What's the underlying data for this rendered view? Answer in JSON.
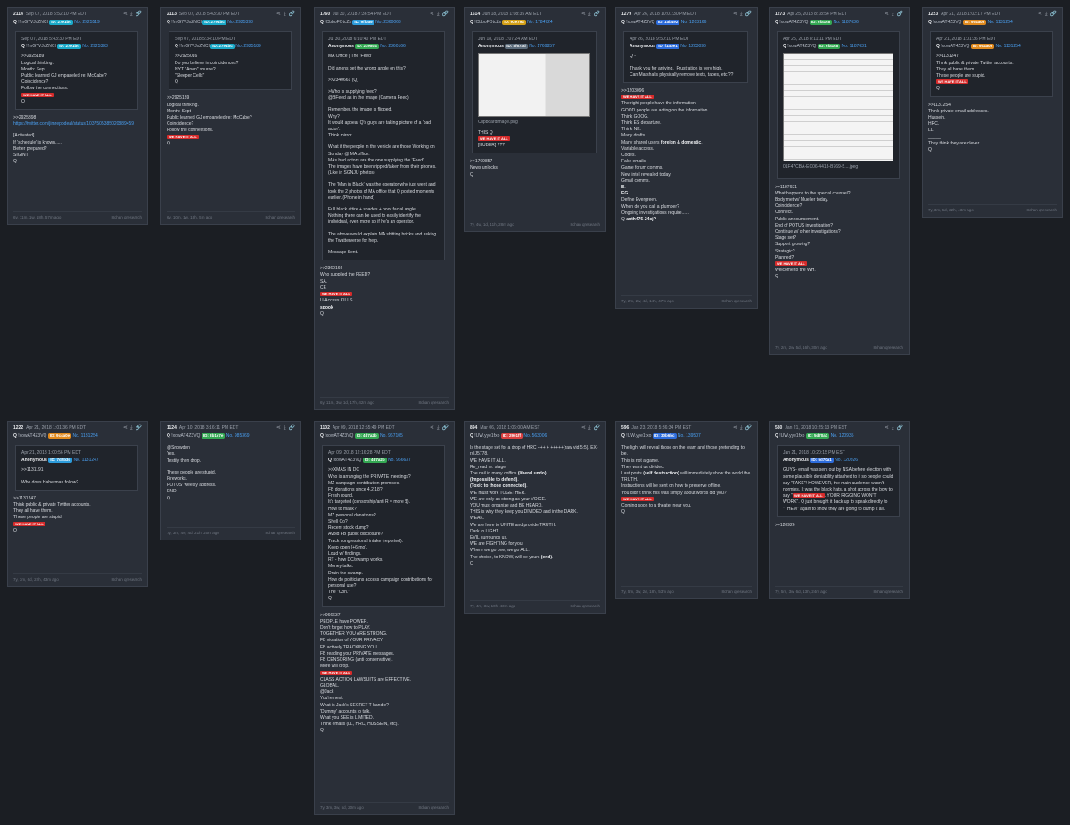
{
  "colors": {
    "bg": "#1b1e23",
    "card": "#2a2f38",
    "link": "#4a9ff0",
    "stamp": "#d62b2b"
  },
  "icons": [
    "share-icon",
    "download-icon",
    "link-icon"
  ],
  "stamp": "WE HAVE IT ALL",
  "posts": [
    {
      "num": "2114",
      "date": "Sep 07, 2018 5:52:10 PM EDT",
      "name": "Q",
      "trip": "!!mG7VJxZNCI",
      "pill": "ID: 27e1bc",
      "pillColor": "#1aa9c8",
      "no": "No. 2925519",
      "quote": {
        "date": "Sep 07, 2018 5:43:30 PM EDT",
        "name": "Q",
        "trip": "!!mG7VJxZNCI",
        "pill": "ID: 27e1bc",
        "pillColor": "#1aa9c8",
        "no": "No. 2925393",
        "lines": [
          ">>2925189",
          "Logical thinking.",
          "Month: Sept",
          "Public learned GJ empaneled re: McCabe?",
          "Coincidence?",
          "Follow the connections.",
          "@STAMP",
          "Q"
        ]
      },
      "lines": [
        ">>2925398",
        "@LINK https://twitter.com/jimrepodeal/status/1037505385020889459",
        "",
        "[Activated]",
        "If 'schedule' is known.....",
        "Better prepared?",
        "SIGINT",
        "Q"
      ],
      "ago": "6y, 11m, 1w, 18h, 57m ago",
      "src": "8chan qresearch"
    },
    {
      "num": "2113",
      "date": "Sep 07, 2018 5:43:30 PM EDT",
      "name": "Q",
      "trip": "!!mG7VJxZNCI",
      "pill": "ID: 27e1bc",
      "pillColor": "#1aa9c8",
      "no": "No. 2925393",
      "quote": {
        "date": "Sep 07, 2018 5:34:10 PM EDT",
        "name": "Q",
        "trip": "!!mG7VJxZNCI",
        "pill": "ID: 27e1bc",
        "pillColor": "#1aa9c8",
        "no": "No. 2925189",
        "lines": [
          ">>2925016",
          "Do you believe in coincidences?",
          "NYT \"Anon\" source?",
          "\"Sleeper Cells\"",
          "Q"
        ]
      },
      "lines": [
        ">>2925189",
        "Logical thinking.",
        "Month: Sept",
        "Public learned GJ empaneled re: McCabe?",
        "Coincidence?",
        "Follow the connections.",
        "@STAMP",
        "Q"
      ],
      "ago": "6y, 10m, 1w, 18h, 5m ago",
      "src": "8chan qresearch"
    },
    {
      "num": "1760",
      "date": "Jul 30, 2018 7:36:54 PM EDT",
      "name": "Q",
      "trip": "!CbboFOtcZs",
      "pill": "ID: 9ff0a9",
      "pillColor": "#2d9cdb",
      "no": "No. 2360063",
      "quote": {
        "date": "Jul 30, 2018 6:10:40 PM EDT",
        "name": "Anonymous",
        "trip": "",
        "pill": "ID: 2ce8d4",
        "pillColor": "#34a853",
        "no": "No. 2360166",
        "lines": [
          "MA Office | The 'Feed'",
          "",
          "Did anons get the wrong angle on this?",
          "",
          ">>2340661 (Q)",
          "",
          ">Who is supplying feed?",
          "@BFeed as in the Image (Camera Feed)",
          "",
          "Remember, the image is flipped.",
          "Why?",
          "It would appear Q's guys are taking picture of a 'bad actor'.",
          "Think mirror.",
          "",
          "What if the people in the vehicle are those Working on Sunday @ MA office.",
          "MAs bad actors are the one supplying the 'Feed'.",
          "The images have been ripped/taken from their phones. (Like in SGNJU photos)",
          "",
          "The 'Man in Black' was the operator who just went and took the 2 photos of MA office that Q posted moments earlier. (Phone in hand)",
          "",
          "Full black attire + shades + poor facial angle.",
          "Nothing there can be used to easily identify the individual, even more so if he's an operator.",
          "",
          "The above would explain MA shitting bricks and asking the Twatterverse for help.",
          "",
          "Message Sent."
        ]
      },
      "lines": [
        ">>2360166",
        "Who supplied the FEED?",
        "SA.",
        "CF.",
        "@STAMP",
        "U-Access KILLS.",
        "@B[spook]",
        "Q"
      ],
      "ago": "6y, 11m, 3w, 1d, 17h, 42m ago",
      "src": "8chan qresearch"
    },
    {
      "num": "1514",
      "date": "Jun 18, 2018 1:08:35 AM EDT",
      "name": "Q",
      "trip": "!CbboFOtcZs",
      "pill": "ID: e2e79a",
      "pillColor": "#d4a017",
      "no": "No. 1784724",
      "quote": {
        "date": "Jun 18, 2018 1:07:24 AM EDT",
        "name": "Anonymous",
        "trip": "",
        "pill": "ID: 8f67ad",
        "pillColor": "#5b6b7a",
        "no": "No. 1769857",
        "image": true,
        "imgcap": "Clipboardimage.png",
        "lines": [
          "THIS Q",
          "@STAMP",
          "[HUBER] ???"
        ]
      },
      "lines": [
        ">>1769857",
        "News unlocks.",
        "Q"
      ],
      "ago": "7y, 4w, 1d, 11h, 28m ago",
      "src": "8chan qresearch"
    },
    {
      "num": "1279",
      "date": "Apr 26, 2018 10:01:30 PM EDT",
      "name": "Q",
      "trip": "!xowAT4Z3VQ",
      "pill": "ID: 1ab4e2",
      "pillColor": "#2d6cdb",
      "no": "No. 1203166",
      "quote": {
        "date": "Apr 26, 2018 9:50:10 PM EDT",
        "name": "Anonymous",
        "trip": "",
        "pill": "ID: f1abe1",
        "pillColor": "#2d6cdb",
        "no": "No. 1203096",
        "lines": [
          "Q -",
          "",
          "Thank you for arriving.  Frustration is very high.",
          "Can Marshalls physically remove texts, tapes, etc.??"
        ]
      },
      "lines": [
        ">>1203096",
        "@STAMP",
        "The right people have the information.",
        "GOOD people are acting on the information.",
        "Think GOOG.",
        "Think ES departure.",
        "Think NK.",
        "Many drafts.",
        "Many shared users @B[foreign & domestic].",
        "Variable access.",
        "Codes.",
        "Fake emails.",
        "Game forum comms.",
        "New intel revealed today.",
        "Gmail comms.",
        "@B[E].",
        "@B[EG].",
        "Define Evergreen.",
        "When do you call a plumber?",
        "Ongoing investigations require......",
        "Q @B[auth476-24cjP]"
      ],
      "ago": "7y, 2m, 2w, 4d, 14h, 47m ago",
      "src": "8chan qresearch"
    },
    {
      "num": "1273",
      "date": "Apr 25, 2018 8:18:54 PM EDT",
      "name": "Q",
      "trip": "!xowAT4Z3VQ",
      "pill": "ID: 6fa1c8",
      "pillColor": "#34a853",
      "no": "No. 1187636",
      "quote": {
        "date": "Apr 25, 2018 8:11:11 PM EDT",
        "name": "Q",
        "trip": "!xowAT4Z3VQ",
        "pill": "ID: 6fa1c8",
        "pillColor": "#34a853",
        "no": "No. 1187631",
        "image": true,
        "imgcap": "01F47CBA-EC06-4413-B769-5....jpeg",
        "lines": []
      },
      "lines": [
        ">>1187631",
        "What happens to the special counsel?",
        "Body met w/ Mueller today.",
        "Coincidence?",
        "Connect.",
        "Public announcement.",
        "End of POTUS investigation?",
        "Continue w/ other investigations?",
        "Stage set?",
        "Support growing?",
        "Strategic?",
        "Planned?",
        "@STAMP",
        "Welcome to the WH.",
        "Q"
      ],
      "ago": "7y, 2m, 2w, 5d, 16h, 30m ago",
      "src": "8chan qresearch"
    },
    {
      "num": "1223",
      "date": "Apr 21, 2018 1:02:17 PM EDT",
      "name": "Q",
      "trip": "!xowAT4Z3VQ",
      "pill": "ID: 9c4a0e",
      "pillColor": "#e08a1e",
      "no": "No. 1131264",
      "quote": {
        "date": "Apr 21, 2018 1:01:36 PM EDT",
        "name": "Q",
        "trip": "!xowAT4Z3VQ",
        "pill": "ID: 9c4a0e",
        "pillColor": "#e08a1e",
        "no": "No. 1131254",
        "lines": [
          ">>1131247",
          "Think public & private Twitter accounts.",
          "They all have them.",
          "These people are stupid.",
          "@STAMP",
          "Q"
        ]
      },
      "lines": [
        ">>1131254",
        "Think private email addresses.",
        "Hussein.",
        "HRC.",
        "LL.",
        "_____",
        "They think they are clever.",
        "Q"
      ],
      "ago": "7y, 3m, 6d, 22h, 43m ago",
      "src": "8chan qresearch"
    },
    {
      "num": "1222",
      "date": "Apr 21, 2018 1:01:36 PM EDT",
      "name": "Q",
      "trip": "!xowAT4Z3VQ",
      "pill": "ID: 9c4a0e",
      "pillColor": "#e08a1e",
      "no": "No. 1131254",
      "quote": {
        "date": "Apr 21, 2018 1:00:56 PM EDT",
        "name": "Anonymous",
        "trip": "",
        "pill": "ID: 7d2b3c",
        "pillColor": "#2d9cdb",
        "no": "No. 1131247",
        "lines": [
          ">>1131191",
          "",
          "Who does Haberman follow?"
        ]
      },
      "lines": [
        ">>1131247",
        "Think public & private Twitter accounts.",
        "They all have them.",
        "These people are stupid.",
        "@STAMP",
        "Q"
      ],
      "ago": "7y, 3m, 6d, 22h, 43m ago",
      "src": "8chan qresearch"
    },
    {
      "num": "1124",
      "date": "Apr 10, 2018 3:16:11 PM EDT",
      "name": "Q",
      "trip": "!xowAT4Z3VQ",
      "pill": "ID: 8b1c7e",
      "pillColor": "#34a853",
      "no": "No. 985369",
      "lines": [
        "@Snowden",
        "Yes.",
        "Testify then drop.",
        "",
        "These people are stupid.",
        "Fireworks.",
        "POTUS' weekly address.",
        "END.",
        "Q"
      ],
      "ago": "7y, 3m, 4w, 4d, 21h, 20m ago",
      "src": "8chan qresearch"
    },
    {
      "num": "1102",
      "date": "Apr 09, 2018 12:55:49 PM EDT",
      "name": "Q",
      "trip": "!xowAT4Z3VQ",
      "pill": "ID: 4d7a2b",
      "pillColor": "#34a853",
      "no": "No. 967105",
      "quote": {
        "date": "Apr 09, 2018 12:16:28 PM EDT",
        "name": "Q",
        "trip": "!xowAT4Z3VQ",
        "pill": "ID: 4d7a2b",
        "pillColor": "#34a853",
        "no": "No. 966637",
        "lines": [
          ">>XMAS IN DC",
          "Who is arranging the PRIVATE meetings?",
          "MZ campaign contribution promises.",
          "FB donations since 4.2.18?",
          "Fresh round.",
          "It's targeted (censorship/anti R = more $).",
          "How to mask?",
          "MZ personal donations?",
          "Shell Co?",
          "Recent stock dump?",
          "Avoid FB public disclosure?",
          "Track congressional intake (reported).",
          "Keep open (+6 mo).",
          "Loud w/ findings.",
          "RT - how DC/swamp works.",
          "Money talks.",
          "Drain the swamp.",
          "How do politicians access campaign contributions for personal use?",
          "The \"Con.\"",
          "Q"
        ]
      },
      "lines": [
        ">>966637",
        "PEOPLE have POWER.",
        "Don't forget how to PLAY.",
        "TOGETHER YOU ARE STRONG.",
        "FB violation of YOUR PRIVACY.",
        "FB actively TRACKING YOU.",
        "FB reading your PRIVATE messages.",
        "FB CENSORING (anti conservative).",
        "More will drop.",
        "@STAMP",
        "CLASS ACTION LAWSUITS are EFFECTIVE.",
        "GLOBAL.",
        "@Jack",
        "You're next.",
        "What is Jack's SECRET T-handle?",
        "'Dummy' accounts to talk.",
        "What you SEE is LIMITED.",
        "Think emails (LL, HRC, HUSSEIN, etc).",
        "Q"
      ],
      "ago": "7y, 3m, 3w, 5d, 20m ago",
      "src": "8chan qresearch"
    },
    {
      "num": "894",
      "date": "Mar 06, 2018 1:06:00 AM EST",
      "name": "Q",
      "trip": "!UW.yye1fxo",
      "pill": "ID: 29e1ff",
      "pillColor": "#d94040",
      "no": "No. 563006",
      "lines": [
        "Is the stage set for a drop of HRC +++ + +++++(raw vid 5:5). EX-rxIJ5778.",
        "WE HAVE IT ALL.",
        "Re_read re: stage.",
        "The nail in many coffins @B[(liberal undo)].",
        "@B[(Impossible to defend)].",
        "@B[(Toxic to those connected)].",
        "WE must work TOGETHER.",
        "WE are only as strong as your VOICE.",
        "YOU must organize and BE HEARD.",
        "THIS is why they keep you DIVIDED and in the DARK.",
        "WEAK.",
        "We are here to UNITE and provide TRUTH.",
        "Dark to LIGHT.",
        "EVIL surrounds us.",
        "WE are FIGHTING for you.",
        "Where we go one, we go ALL.",
        "The choice, to KNOW, will be yours @B[(end)].",
        "Q"
      ],
      "ago": "7y, 4m, 3w, 10h, 43m ago",
      "src": "8chan qresearch"
    },
    {
      "num": "596",
      "date": "Jan 23, 2018 5:36:34 PM EST",
      "name": "Q",
      "trip": "!UW.yye1fxo",
      "pill": "ID: 30b6bc",
      "pillColor": "#2d6cdb",
      "no": "No. 139507",
      "lines": [
        "The light will reveal those on the team and those pretending to be.",
        "This is not a game.",
        "They want us divided.",
        "Last posts @B[(self destruction)] will immediately show the world the TRUTH.",
        "Instructions will be sent on how to preserve offline.",
        "You didn't think this was simply about words did you?",
        "@STAMP",
        "Coming soon to a theater near you.",
        "Q"
      ],
      "ago": "7y, 5m, 3w, 2d, 18h, 53m ago",
      "src": "8chan qresearch"
    },
    {
      "num": "580",
      "date": "Jan 21, 2018 10:25:13 PM EST",
      "name": "Q",
      "trip": "!UW.yye1fxo",
      "pill": "ID: 5d70a1",
      "pillColor": "#34a853",
      "no": "No. 120935",
      "quote": {
        "date": "Jan 21, 2018 10:20:15 PM EST",
        "name": "Anonymous",
        "trip": "",
        "pill": "ID: 5d70a1",
        "pillColor": "#2d6cdb",
        "no": "No. 120926",
        "lines": [
          "GUYS- email was sent out by NSA before election with some plausible deniability attached to it so people could say \"FAKE\"! HOWEVER, the main audience wasn't normies. It was the black hats, a shot across the bow to say \"@STAMP. YOUR RIGGING WON'T WORK\". Q just brought it back up to speak directly to \"THEM\" again to show they are going to dump it all."
        ]
      },
      "lines": [
        ">>120926"
      ],
      "ago": "7y, 5m, 3w, 6d, 13h, 24m ago",
      "src": "8chan qresearch"
    }
  ]
}
